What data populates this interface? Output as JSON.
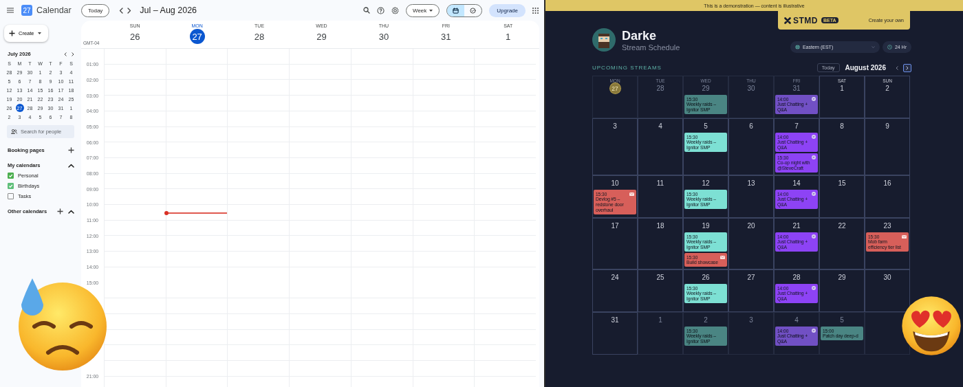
{
  "calendar_app": {
    "logo_text": "27",
    "title": "Calendar",
    "today_button": "Today",
    "range": "Jul – Aug 2026",
    "view_button": "Week",
    "view_toggle": [
      {
        "kind": "calendar",
        "selected": true
      },
      {
        "kind": "tasks",
        "selected": false
      }
    ],
    "upgrade_button": "Upgrade",
    "create_button": "Create",
    "mini_month": {
      "title": "July 2026",
      "weekdays": [
        "S",
        "M",
        "T",
        "W",
        "T",
        "F",
        "S"
      ],
      "weeks": [
        [
          {
            "day": "28",
            "selected": false
          },
          {
            "day": "29",
            "selected": false
          },
          {
            "day": "30",
            "selected": false
          },
          {
            "day": "1",
            "selected": false
          },
          {
            "day": "2",
            "selected": false
          },
          {
            "day": "3",
            "selected": false
          },
          {
            "day": "4",
            "selected": false
          }
        ],
        [
          {
            "day": "5",
            "selected": false
          },
          {
            "day": "6",
            "selected": false
          },
          {
            "day": "7",
            "selected": false
          },
          {
            "day": "8",
            "selected": false
          },
          {
            "day": "9",
            "selected": false
          },
          {
            "day": "10",
            "selected": false
          },
          {
            "day": "11",
            "selected": false
          }
        ],
        [
          {
            "day": "12",
            "selected": false
          },
          {
            "day": "13",
            "selected": false
          },
          {
            "day": "14",
            "selected": false
          },
          {
            "day": "15",
            "selected": false
          },
          {
            "day": "16",
            "selected": false
          },
          {
            "day": "17",
            "selected": false
          },
          {
            "day": "18",
            "selected": false
          }
        ],
        [
          {
            "day": "19",
            "selected": false
          },
          {
            "day": "20",
            "selected": false
          },
          {
            "day": "21",
            "selected": false
          },
          {
            "day": "22",
            "selected": false
          },
          {
            "day": "23",
            "selected": false
          },
          {
            "day": "24",
            "selected": false
          },
          {
            "day": "25",
            "selected": false
          }
        ],
        [
          {
            "day": "26",
            "selected": false
          },
          {
            "day": "27",
            "selected": true
          },
          {
            "day": "28",
            "selected": false
          },
          {
            "day": "29",
            "selected": false
          },
          {
            "day": "30",
            "selected": false
          },
          {
            "day": "31",
            "selected": false
          },
          {
            "day": "1",
            "selected": false
          }
        ],
        [
          {
            "day": "2",
            "selected": false
          },
          {
            "day": "3",
            "selected": false
          },
          {
            "day": "4",
            "selected": false
          },
          {
            "day": "5",
            "selected": false
          },
          {
            "day": "6",
            "selected": false
          },
          {
            "day": "7",
            "selected": false
          },
          {
            "day": "8",
            "selected": false
          }
        ]
      ]
    },
    "search_people": {
      "placeholder": "Search for people"
    },
    "booking_pages": "Booking pages",
    "my_calendars": {
      "title": "My calendars",
      "expanded": true,
      "items": [
        {
          "label": "Personal",
          "checked": true,
          "color": "#4caf50"
        },
        {
          "label": "Birthdays",
          "checked": true,
          "color": "#5fbf7a"
        },
        {
          "label": "Tasks",
          "checked": false,
          "color": "#8a8a8a"
        }
      ]
    },
    "other_calendars": {
      "title": "Other calendars",
      "expanded": true
    },
    "timezone": "GMT-04",
    "days": [
      {
        "weekday": "SUN",
        "date": "26",
        "today": false
      },
      {
        "weekday": "MON",
        "date": "27",
        "today": true
      },
      {
        "weekday": "TUE",
        "date": "28",
        "today": false
      },
      {
        "weekday": "WED",
        "date": "29",
        "today": false
      },
      {
        "weekday": "THU",
        "date": "30",
        "today": false
      },
      {
        "weekday": "FRI",
        "date": "31",
        "today": false
      },
      {
        "weekday": "SAT",
        "date": "1",
        "today": false
      }
    ],
    "hours_top": [
      "01:00",
      "02:00",
      "03:00",
      "04:00",
      "05:00",
      "06:00",
      "07:00",
      "08:00",
      "09:00",
      "10:00",
      "11:00",
      "12:00",
      "13:00",
      "14:00",
      "15:00"
    ],
    "hours_bottom": [
      "21:00"
    ]
  },
  "stream_schedule": {
    "banner": "This is a demonstration — content is illustrative",
    "brand": {
      "name": "STMD",
      "badge": "BETA",
      "link": "Create your own"
    },
    "streamer": {
      "name": "Darke",
      "subtitle": "Stream Schedule"
    },
    "timezone": {
      "value": "Eastern (EST)"
    },
    "clock_format": "24 Hr",
    "section_title": "UPCOMING STREAMS",
    "today_button": "Today",
    "month": "August 2026",
    "nav": [
      {
        "focused": false
      },
      {
        "focused": true
      }
    ],
    "cells": [
      {
        "weekday": "MON",
        "day": "27",
        "outside_month": true,
        "today": true
      },
      {
        "weekday": "TUE",
        "day": "28",
        "outside_month": true,
        "today": false
      },
      {
        "weekday": "WED",
        "day": "29",
        "outside_month": true,
        "today": false,
        "events": [
          {
            "time": "15:30",
            "title": "Weekly raids – Ignitor SMP",
            "color": "#4a8583",
            "kind": "plain"
          }
        ]
      },
      {
        "weekday": "THU",
        "day": "30",
        "outside_month": true,
        "today": false
      },
      {
        "weekday": "FRI",
        "day": "31",
        "outside_month": true,
        "today": false,
        "events": [
          {
            "time": "14:00",
            "title": "Just Chatting + Q&A",
            "color": "#7150c4",
            "kind": "chat"
          }
        ]
      },
      {
        "weekday": "SAT",
        "day": "1",
        "outside_month": false,
        "today": false
      },
      {
        "weekday": "SUN",
        "day": "2",
        "outside_month": false,
        "today": false
      },
      {
        "day": "3",
        "outside_month": false,
        "today": false
      },
      {
        "day": "4",
        "outside_month": false,
        "today": false
      },
      {
        "day": "5",
        "outside_month": false,
        "today": false,
        "events": [
          {
            "time": "15:30",
            "title": "Weekly raids – Ignitor SMP",
            "color": "#7de0d4",
            "kind": "plain"
          }
        ]
      },
      {
        "day": "6",
        "outside_month": false,
        "today": false
      },
      {
        "day": "7",
        "outside_month": false,
        "today": false,
        "events": [
          {
            "time": "14:00",
            "title": "Just Chatting + Q&A",
            "color": "#8d43f5",
            "kind": "chat"
          },
          {
            "time": "15:30",
            "title": "Co-op night with @SteveCraft",
            "color": "#8d43f5",
            "kind": "chat"
          }
        ]
      },
      {
        "day": "8",
        "outside_month": false,
        "today": false
      },
      {
        "day": "9",
        "outside_month": false,
        "today": false
      },
      {
        "day": "10",
        "outside_month": false,
        "today": false,
        "events": [
          {
            "time": "15:30",
            "title": "Devlog #5 – redstone door overhaul",
            "color": "#d75f5a",
            "kind": "mail"
          }
        ]
      },
      {
        "day": "11",
        "outside_month": false,
        "today": false
      },
      {
        "day": "12",
        "outside_month": false,
        "today": false,
        "events": [
          {
            "time": "15:30",
            "title": "Weekly raids – Ignitor SMP",
            "color": "#7de0d4",
            "kind": "plain"
          }
        ]
      },
      {
        "day": "13",
        "outside_month": false,
        "today": false
      },
      {
        "day": "14",
        "outside_month": false,
        "today": false,
        "events": [
          {
            "time": "14:00",
            "title": "Just Chatting + Q&A",
            "color": "#8d43f5",
            "kind": "chat"
          }
        ]
      },
      {
        "day": "15",
        "outside_month": false,
        "today": false
      },
      {
        "day": "16",
        "outside_month": false,
        "today": false
      },
      {
        "day": "17",
        "outside_month": false,
        "today": false
      },
      {
        "day": "18",
        "outside_month": false,
        "today": false
      },
      {
        "day": "19",
        "outside_month": false,
        "today": false,
        "events": [
          {
            "time": "15:30",
            "title": "Weekly raids – Ignitor SMP",
            "color": "#7de0d4",
            "kind": "plain"
          },
          {
            "time": "15:30",
            "title": "Build showcase",
            "color": "#d75f5a",
            "kind": "mail"
          }
        ]
      },
      {
        "day": "20",
        "outside_month": false,
        "today": false
      },
      {
        "day": "21",
        "outside_month": false,
        "today": false,
        "events": [
          {
            "time": "14:00",
            "title": "Just Chatting + Q&A",
            "color": "#8d43f5",
            "kind": "chat"
          }
        ]
      },
      {
        "day": "22",
        "outside_month": false,
        "today": false
      },
      {
        "day": "23",
        "outside_month": false,
        "today": false,
        "events": [
          {
            "time": "15:30",
            "title": "Mob farm efficiency tier list",
            "color": "#d75f5a",
            "kind": "mail"
          }
        ]
      },
      {
        "day": "24",
        "outside_month": false,
        "today": false
      },
      {
        "day": "25",
        "outside_month": false,
        "today": false
      },
      {
        "day": "26",
        "outside_month": false,
        "today": false,
        "events": [
          {
            "time": "15:30",
            "title": "Weekly raids – Ignitor SMP",
            "color": "#7de0d4",
            "kind": "plain"
          }
        ]
      },
      {
        "day": "27",
        "outside_month": false,
        "today": false
      },
      {
        "day": "28",
        "outside_month": false,
        "today": false,
        "events": [
          {
            "time": "14:00",
            "title": "Just Chatting + Q&A",
            "color": "#8d43f5",
            "kind": "chat"
          }
        ]
      },
      {
        "day": "29",
        "outside_month": false,
        "today": false
      },
      {
        "day": "30",
        "outside_month": false,
        "today": false
      },
      {
        "day": "31",
        "outside_month": false,
        "today": false
      },
      {
        "day": "1",
        "outside_month": true,
        "today": false
      },
      {
        "day": "2",
        "outside_month": true,
        "today": false,
        "events": [
          {
            "time": "15:30",
            "title": "Weekly raids – Ignitor SMP",
            "color": "#4a8583",
            "kind": "plain"
          }
        ]
      },
      {
        "day": "3",
        "outside_month": true,
        "today": false
      },
      {
        "day": "4",
        "outside_month": true,
        "today": false,
        "events": [
          {
            "time": "14:00",
            "title": "Just Chatting + Q&A",
            "color": "#7150c4",
            "kind": "chat"
          }
        ]
      },
      {
        "day": "5",
        "outside_month": true,
        "today": false,
        "events": [
          {
            "time": "15:00",
            "title": "Patch day deep-d",
            "color": "#4a8583",
            "kind": "plain"
          }
        ]
      },
      {
        "outside_month": true
      }
    ]
  }
}
